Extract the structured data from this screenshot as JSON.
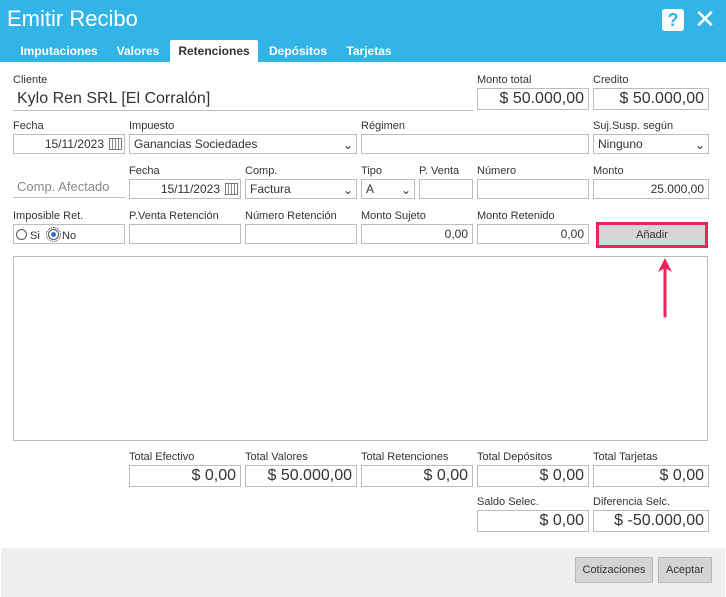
{
  "window": {
    "title": "Emitir Recibo",
    "help": "?",
    "close": "✕"
  },
  "tabs": [
    {
      "label": "Imputaciones"
    },
    {
      "label": "Valores"
    },
    {
      "label": "Retenciones"
    },
    {
      "label": "Depósitos"
    },
    {
      "label": "Tarjetas"
    }
  ],
  "active_tab": "Retenciones",
  "header": {
    "cliente_label": "Cliente",
    "cliente_value": "Kylo Ren SRL [El Corralón]",
    "monto_total_label": "Monto total",
    "monto_total_value": "$ 50.000,00",
    "credito_label": "Credito",
    "credito_value": "$ 50.000,00"
  },
  "row2": {
    "fecha_label": "Fecha",
    "fecha_value": "15/11/2023",
    "impuesto_label": "Impuesto",
    "impuesto_value": "Ganancias Sociedades",
    "regimen_label": "Régimen",
    "regimen_value": "",
    "suj_label": "Suj.Susp. según",
    "suj_value": "Ninguno"
  },
  "row3": {
    "comp_afectado_placeholder": "Comp. Afectado",
    "fecha_label": "Fecha",
    "fecha_value": "15/11/2023",
    "comp_label": "Comp.",
    "comp_value": "Factura",
    "tipo_label": "Tipo",
    "tipo_value": "A",
    "pventa_label": "P. Venta",
    "pventa_value": "",
    "numero_label": "Número",
    "numero_value": "",
    "monto_label": "Monto",
    "monto_value": "25.000,00"
  },
  "row4": {
    "imposible_label": "Imposible Ret.",
    "si_label": "Si",
    "no_label": "No",
    "selected": "No",
    "pventa_ret_label": "P.Venta Retención",
    "pventa_ret_value": "",
    "numero_ret_label": "Número Retención",
    "numero_ret_value": "",
    "monto_sujeto_label": "Monto Sujeto",
    "monto_sujeto_value": "0,00",
    "monto_retenido_label": "Monto Retenido",
    "monto_retenido_value": "0,00",
    "add_button": "Añadir"
  },
  "totals": {
    "efectivo_label": "Total Efectivo",
    "efectivo_value": "$ 0,00",
    "valores_label": "Total Valores",
    "valores_value": "$ 50.000,00",
    "retenciones_label": "Total Retenciones",
    "retenciones_value": "$ 0,00",
    "depositos_label": "Total Depósitos",
    "depositos_value": "$ 0,00",
    "tarjetas_label": "Total Tarjetas",
    "tarjetas_value": "$ 0,00",
    "saldo_label": "Saldo Selec.",
    "saldo_value": "$ 0,00",
    "diferencia_label": "Diferencia Selc.",
    "diferencia_value": "$ -50.000,00"
  },
  "footer": {
    "cotizaciones": "Cotizaciones",
    "aceptar": "Aceptar"
  },
  "colors": {
    "titlebar": "#33b4e6",
    "highlight": "#e8265c",
    "radio": "#2a6fd9"
  }
}
